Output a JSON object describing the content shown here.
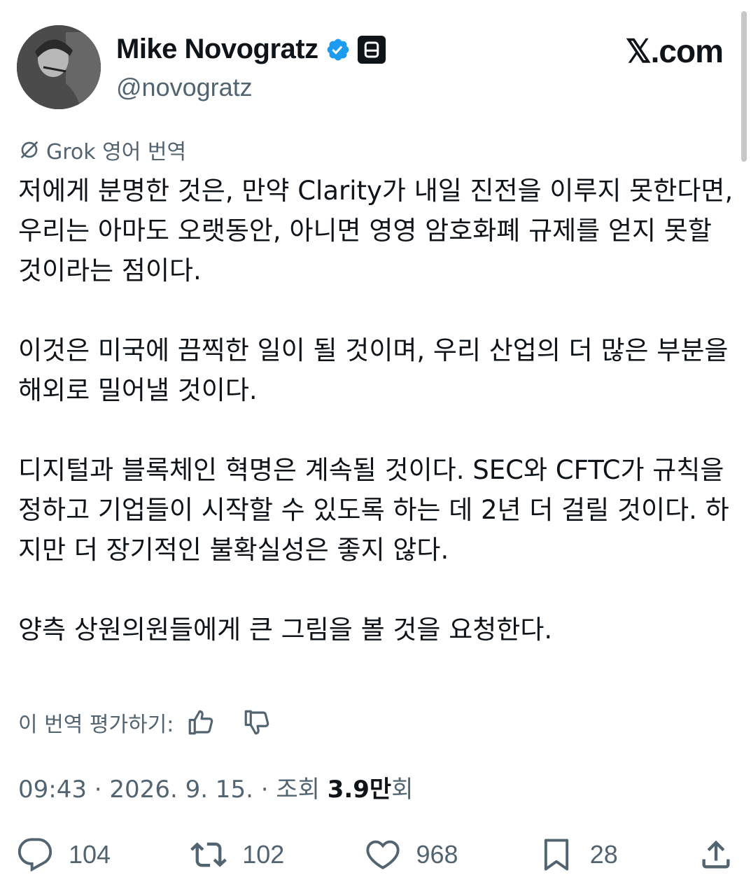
{
  "author": {
    "display_name": "Mike Novogratz",
    "handle": "@novogratz"
  },
  "brand": "𝕏.com",
  "grok": {
    "label": "Grok 영어 번역"
  },
  "tweet": {
    "paragraphs": [
      "저에게 분명한 것은, 만약 Clarity가 내일 진전을 이루지 못한다면, 우리는 아마도 오랫동안, 아니면 영영 암호화폐 규제를 얻지 못할 것이라는 점이다.",
      "이것은 미국에 끔찍한 일이 될 것이며, 우리 산업의 더 많은 부분을 해외로 밀어낼 것이다.",
      "디지털과 블록체인 혁명은 계속될 것이다. SEC와 CFTC가 규칙을 정하고 기업들이 시작할 수 있도록 하는 데 2년 더 걸릴 것이다. 하지만 더 장기적인 불확실성은 좋지 않다.",
      "양측 상원의원들에게 큰 그림을 볼 것을 요청한다."
    ]
  },
  "rate_translation": {
    "label": "이 번역 평가하기:"
  },
  "meta": {
    "time": "09:43",
    "separator": " · ",
    "date": "2026. 9. 15.",
    "views_prefix": "조회 ",
    "views_count": "3.9만",
    "views_suffix": "회"
  },
  "actions": {
    "replies": "104",
    "reposts": "102",
    "likes": "968",
    "bookmarks": "28"
  },
  "colors": {
    "verified": "#1d9bf0",
    "text": "#0f1419",
    "muted": "#536471"
  }
}
